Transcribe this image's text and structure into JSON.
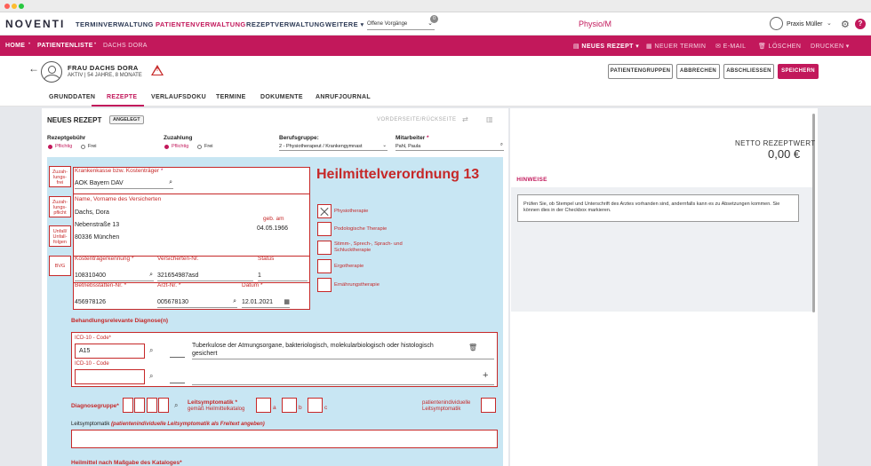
{
  "nav": {
    "logo": "NOVENTI",
    "items": [
      "TERMINVERWALTUNG",
      "PATIENTENVERWALTUNG",
      "REZEPTVERWALTUNG",
      "WEITERE"
    ],
    "vorgaenge_value": "Offene Vorgänge",
    "badge": "0",
    "app_name": "Physio/M",
    "user_name": "Praxis Müller",
    "help": "?"
  },
  "breadcrumb": {
    "home": "HOME",
    "list": "PATIENTENLISTE",
    "current": "DACHS DORA"
  },
  "actions": {
    "new_recipe": "NEUES REZEPT",
    "new_appointment": "NEUER TERMIN",
    "email": "E-MAIL",
    "delete": "LÖSCHEN",
    "print": "DRUCKEN"
  },
  "patient": {
    "name": "FRAU DACHS DORA",
    "meta": "AKTIV  |  54 JAHRE, 8 MONATE"
  },
  "header_buttons": {
    "groups": "PATIENTENGRUPPEN",
    "cancel": "ABBRECHEN",
    "finish": "ABSCHLIESSEN",
    "save": "SPEICHERN"
  },
  "tabs": [
    "GRUNDDATEN",
    "REZEPTE",
    "VERLAUFSDOKU",
    "TERMINE",
    "DOKUMENTE",
    "ANRUFJOURNAL"
  ],
  "recipe": {
    "title": "NEUES REZEPT",
    "status": "ANGELEGT",
    "side_label": "VORDERSEITE/RÜCKSEITE",
    "fee_label": "Rezeptgebühr",
    "copay_label": "Zuzahlung",
    "opt_required": "Pflichtig",
    "opt_free": "Frei",
    "profession_label": "Berufsgruppe:",
    "profession_value": "2 - Physiotherapeut / Krankengymnast",
    "employee_label": "Mitarbeiter",
    "employee_value": "Pahl, Paula"
  },
  "form": {
    "side_boxes": [
      "Zuzah-\nlungs-\nfrei",
      "Zuzah-\nlungs-\npflicht",
      "Unfall/\nUnfall-\nfolgen",
      "BVG"
    ],
    "insurer_label": "Krankenkasse bzw. Kostenträger",
    "insurer_value": "AOK Bayern DAV",
    "insured_label": "Name, Vorname des Versicherten",
    "insured_name": "Dachs, Dora",
    "street": "Nebenstraße 13",
    "city": "80336 München",
    "birth_label": "geb. am",
    "birth_value": "04.05.1966",
    "kt_label": "Kostenträgerkennung",
    "kt_value": "108310400",
    "vnr_label": "Versicherten-Nr.",
    "vnr_value": "321654987asd",
    "status_label": "Status",
    "status_value": "1",
    "bsnr_label": "Betriebsstätten-Nr.",
    "bsnr_value": "456978126",
    "lanr_label": "Arzt-Nr.",
    "lanr_value": "005678130",
    "date_label": "Datum",
    "date_value": "12.01.2021",
    "heading": "Heilmittelverordnung 13",
    "therapies": [
      "Physiotherapie",
      "Podologische Therapie",
      "Stimm-, Sprech-, Sprach- und Schlucktherapie",
      "Ergotherapie",
      "Ernährungstherapie"
    ],
    "diagnosis_section": "Behandlungsrelevante Diagnose(n)",
    "icd_label1": "ICD-10 - Code*",
    "icd_value1": "A15",
    "icd_desc1": "Tuberkulose der Atmungsorgane, bakteriologisch, molekularbiologisch oder histologisch gesichert",
    "icd_label2": "ICD-10 - Code",
    "diag_group_label": "Diagnosegruppe*",
    "leitsym_label": "Leitsymptomatik *",
    "leitsym_sub": "gemäß Heilmittelkatalog",
    "opt_a": "a",
    "opt_b": "b",
    "opt_c": "c",
    "patient_specific": "patientenindividuelle Leitsymptomatik",
    "leitsym_free_label": "Leitsymptomatik",
    "leitsym_free_hint": "(patientenindividuelle Leitsymptomatik als Freitext angeben)",
    "catalog_label": "Heilmittel nach Maßgabe des Kataloges*"
  },
  "right": {
    "netto_label": "NETTO REZEPTWERT",
    "netto_value": "0,00 €",
    "hint_tab": "HINWEISE",
    "hint_text": "Prüfen Sie, ob Stempel und Unterschrift des Arztes vorhanden sind, andernfalls kann es zu Absetzungen kommen. Sie können dies in der Checkbox markieren."
  }
}
